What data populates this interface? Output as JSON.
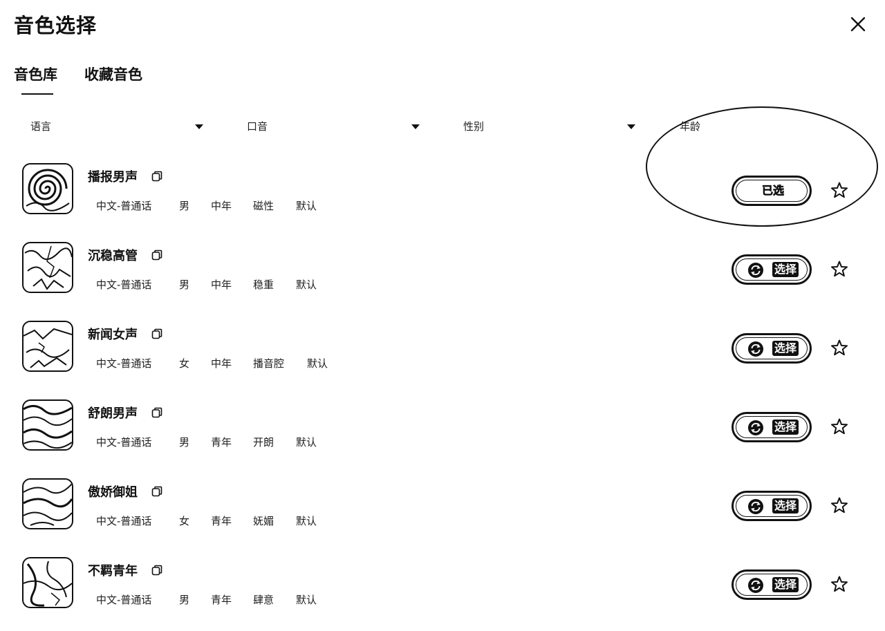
{
  "dialog": {
    "title": "音色选择"
  },
  "tabs": [
    {
      "label": "音色库",
      "active": true
    },
    {
      "label": "收藏音色",
      "active": false
    }
  ],
  "filters": [
    {
      "label": "语言"
    },
    {
      "label": "口音"
    },
    {
      "label": "性别"
    },
    {
      "label": "年龄"
    }
  ],
  "voices": [
    {
      "name": "播报男声",
      "tags": [
        "中文-普通话",
        "男",
        "中年",
        "磁性",
        "默认"
      ],
      "button_label": "已选",
      "selected": true,
      "avatar_icon": "swirl-avatar-icon"
    },
    {
      "name": "沉稳高管",
      "tags": [
        "中文-普通话",
        "男",
        "中年",
        "稳重",
        "默认"
      ],
      "button_label": "选择",
      "selected": false,
      "avatar_icon": "marble-avatar-icon"
    },
    {
      "name": "新闻女声",
      "tags": [
        "中文-普通话",
        "女",
        "中年",
        "播音腔",
        "默认"
      ],
      "button_label": "选择",
      "selected": false,
      "avatar_icon": "marble-avatar-icon"
    },
    {
      "name": "舒朗男声",
      "tags": [
        "中文-普通话",
        "男",
        "青年",
        "开朗",
        "默认"
      ],
      "button_label": "选择",
      "selected": false,
      "avatar_icon": "wave-avatar-icon"
    },
    {
      "name": "傲娇御姐",
      "tags": [
        "中文-普通话",
        "女",
        "青年",
        "妩媚",
        "默认"
      ],
      "button_label": "选择",
      "selected": false,
      "avatar_icon": "wave-avatar-icon"
    },
    {
      "name": "不羁青年",
      "tags": [
        "中文-普通话",
        "男",
        "青年",
        "肆意",
        "默认"
      ],
      "button_label": "选择",
      "selected": false,
      "avatar_icon": "marble-avatar-icon"
    }
  ]
}
